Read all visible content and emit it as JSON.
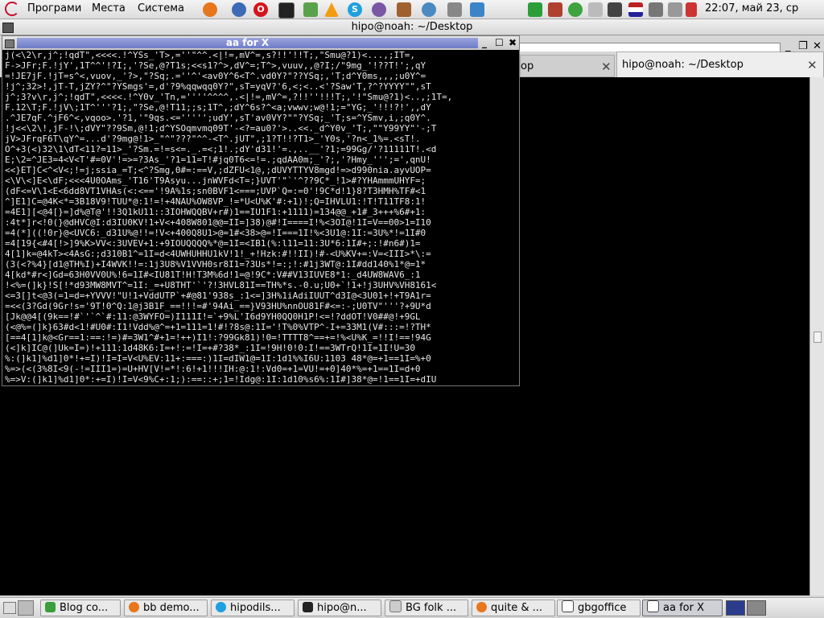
{
  "top_panel": {
    "menus": [
      "Програми",
      "Места",
      "Система"
    ],
    "clock": "22:07, май 23, ср",
    "tray_icons": [
      "firefox-icon",
      "thunderbird-icon",
      "opera-icon",
      "terminal-icon",
      "network-manager-icon",
      "vlc-icon",
      "skype-icon",
      "pidgin-icon",
      "archive-icon",
      "earth-icon",
      "disk-icon",
      "screenshot-icon",
      "evolution-icon",
      "gtk-icon",
      "notes-icon",
      "bluetooth-icon",
      "network-icon",
      "flag-icon",
      "volume-icon",
      "battery-icon"
    ]
  },
  "terminal": {
    "title": "hipo@noah: ~/Desktop",
    "tabs": [
      {
        "label": "op",
        "active": false
      },
      {
        "label": "hipo@noah: ~/Desktop",
        "active": true
      }
    ]
  },
  "aa_window": {
    "title": "aa for X",
    "art": "j(<\\2\\r,j^;!qdT\",<<<<.!^YSs_'T>,=''\"^^.<|!=,mV^=,s?!!'!!T;,\"Smu@?1)<...,;IT=,\nF->JFr;F.!jY',1T^^'!?I;,'?Se,@?T1s;<<s1?^>,dV^=;T^>,vuuv,,@?I;/\"9mg_'!??T!';,qY\n=!JE7jF.!jT=s^<,vuov,_'?>,\"?Sq;.=''^'<av0Y^6<T^.vd0Y?\"??YSq;,'T;d^Y0ms,,,;u0Y^=\n!j^;32>!,jT-T,jZY?^\"?YSmgs'=,d'?9%qqwqq0Y?\",sT=yqV?'6,<;<..<'?Saw'T,?^?YYYY\"\",sT\nj^;3?v\\r,j^;!qdT\",<<<<.!^Y0v_'Tn,=''''^^^^,.<|!=,mV^=,?!!''!!!T;,'!\"Smu@?1)<..,;1T=,\nF.12\\T;F.!jV\\;1T^'''?1;,\"?Se,@!T11;;s;1T^,;dY^6s?^<a;vwwv;w@!1;=\"YG;_'!!!?!',,dY\n.^JE7qF.^jF6^<,vqoo>.'?1,'\"9qs.<=''''';udY',sT'av0VY?\"\"?YSq;_'T;s=^YSmv,i,;q0Y^.\n!j<<\\2\\!,jF-!\\;dVY\"??9Sm,@!1;d^YSOqmvmq09T'-<?=au0?'>..<<._d^Y0v_'T;,\"\"Y99YY\"'-;T\njV>JFrqF6T\\qY^=...d'?9mg@!1>_\"^\"???\"^^-<T^.jUT\",;1?T!!?T1>_'Y0s,'?n<_1%=.<sT!.\nO^+3(<)32\\1\\dT<11?=11>_'?Sm.=!=s<=._.=<;1!.;dY'd31!'=.,..__'?1;=99Gg/'?11111T!.<d\nE;\\2=^JE3=4<V<T'#=0V'!=>=?3As_'?1=11=T!#jq0T6<=!=.;qdAA0m;_'?;,'?Hmy_''';=',qnU!\n<<}ET]C<^<V<;!=j;ssia_=T;<^?Smg,0#=:==V,;dZFU<1@,;dUVYTTYV8mgd!=>d990nia.ayvUOP=\n<\\V\\<]E<\\dF;<<<4U0OAms_'T16'T9Asyu...jnWVFd<T=;}UVT'\"`'^??9C*_!1>#?YHAmmmUHYF=;\n(dF<=V\\1<E<6dd8VT1VHAs(<:<=='!9A%1s;sn0BVF1<===;UVP`Q=:=0'!9C*d!1}8?T3HMH%TF#<1\n^]E1]C=@4K<*=3B18V9!TUU*@:1!=!+4NAU%OW8VP_!=*U<U%K'#:+1)!;Q=IHVLU1:!T!T11TF8:1!\n=4E1][<@4[}=]d%@T@'!!3Q1kU11::3IOHWQQBV+r#)1==IU1F1:+1111)=134@@_+1#_3+++%6#+1:\n:4t*]r<!0(}@dHVC@I:d3IU0KV!1+V<+408W801@@=II=]38)@#!I====I!%<3OI@!1I=V==00>1=I10\n=4(*]((!0r}@<UVC6:_d31U%@!!=!V<+400Q8U1>@=1#<38>@=!I===1I!%<3U1@:1I:=3U%*!=1I#0\n=4[19{<#4[!>]9%K>VV<:3UVEV+1:+9IOUQQQQ%*@=1I=<IB1(%:l11=11:3U*6:1I#+;:!#n6#)1=\n4[1]k=@4kT><4AsG:;d310B1^=1I=d<4UWHUHHU1kV!1!_+!Hzk:#!!II)!#-<U%KV+=:V=<III>*\\:=\n(3(<?%4}[d1@TH%I)+I4WVK!!=:1j3U8%V1VVH0sr8I1=?3Us*!=:;!:#1j3WT@:1I#dd140%1*@=1*\n4[kd*#r<]Gd=63H0VV0U%!6=1I#<IU81T!H!T3M%6d!1=@!9C*:V##V13IUVE8*1:_d4UW8WAV6_:1\n!<%=(]k}!S[!*d93MW8MVT^=1I:_=+U8THT'`'?!3HVL81I==TH%*s.-0.u;U0+`!1+!j3UHV%VH8161<\n<=3[]t<@3(=1=d=+YVVV!\"U!1+VddUTP`+#@81'938s_:1<=]3H%1iAdiIUUT^d3I@<3U01+!+T9A1r=\n=<<(3?Gd(9Gr!s='9T!0^Q:1@j3B1F_==!!!=#'94Ai_==}V93HU%nnOU81F#<=:-;U0TV\"'''?+9U*d\n[Jk@@4[(9k==!#`'`^`#:11:@3WYFO=)I111I!=`+9%L'I6d9YH0QQ0H1P!<=!?ddOT!V0##@!+9GL\n(<@%=(]k}63#d<1!#U0#:I1!Vdd%@^=+1=111=1!#!?8s@:1I='!T%0%VTP^-I+=33M1(V#:::=!?TH*\n[==4[1]k@<Gr==1:==:!=)#=3W1^#+1=!++)I1!:?99Gk81)!0=!TTTT8^==+=!%<U%K_=!!I!==!94G\n(<]k]IC@(]Uk=I=)!+111:1d48K6:I=+!:=!I=+#?38*_:1I=!9H!0!0:I!==3WTrQ!1I=1I!U=30\n%:(]k1]%d1]0*!+=I)!I=I=V<U%EV:11+:===:)1I=dIW1@=1I:1d1%%I6U:1103 48*@=+1==1I=%+0\n%=>(<(3%8I<9(-!=III1=)=U+HV[V!=*!:6!+1!!!IH:@:1!:Vd0=+1=VU!=+0]40*%=+1==1I=d+0\n%=>V:(]k1]%d1]0*:+=I)!I=V<9%C+:1;):==::+;1=!Idg@:1I:1d10%s6%:1I#]38*@=!1==1I=+dIU"
  },
  "taskbar": {
    "tasks": [
      {
        "label": "Blog co...",
        "icon": "chat-icon",
        "active": false
      },
      {
        "label": "bb demo...",
        "icon": "firefox-icon",
        "active": false
      },
      {
        "label": "hipodils...",
        "icon": "skype-icon",
        "active": false
      },
      {
        "label": "hipo@n...",
        "icon": "terminal-icon",
        "active": false
      },
      {
        "label": "BG folk ...",
        "icon": "document-icon",
        "active": false
      },
      {
        "label": "quite & ...",
        "icon": "firefox-icon",
        "active": false
      },
      {
        "label": "gbgoffice",
        "icon": "dictionary-icon",
        "active": false
      },
      {
        "label": "aa for X",
        "icon": "window-icon",
        "active": true
      }
    ]
  },
  "colors": {
    "aa_titlebar": "#7f8ad0",
    "terminal_bg": "#000000",
    "panel_bg": "#e6e6e6"
  }
}
